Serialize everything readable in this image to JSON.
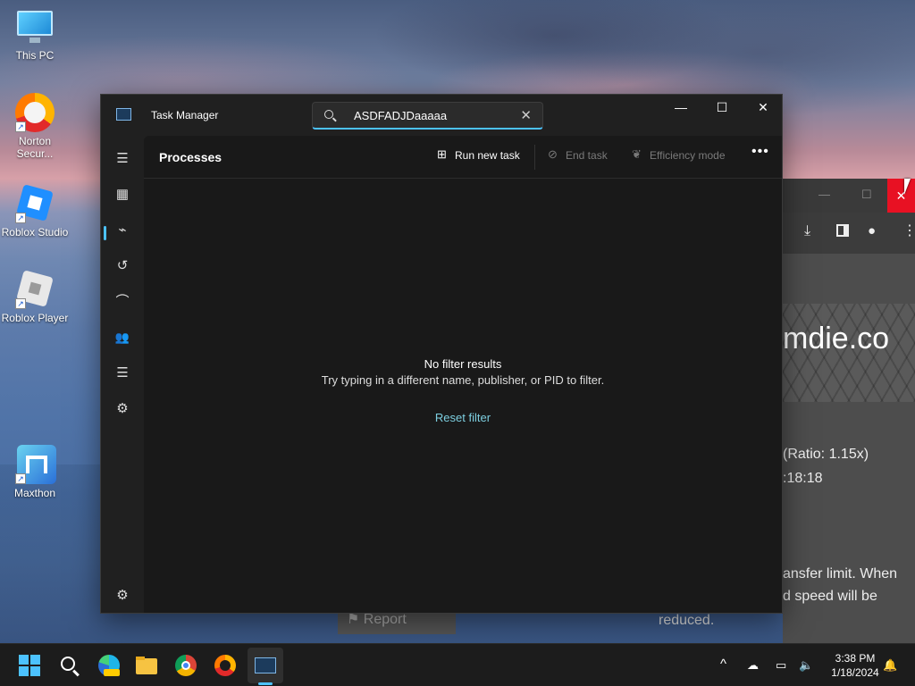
{
  "desktop": {
    "icons": [
      {
        "label": "This PC"
      },
      {
        "label": "Norton Secur..."
      },
      {
        "label": "Roblox Studio"
      },
      {
        "label": "Roblox Player"
      },
      {
        "label": "Maxthon"
      }
    ]
  },
  "background_browser": {
    "close_glyph": "✕",
    "heading_fragment": "mdie.co",
    "ratio_text": "(Ratio: 1.15x)",
    "time_text": ":18:18",
    "limit_line1": "ansfer limit. When",
    "limit_line2": "d speed will be",
    "limit_line3": "reduced.",
    "report_label": "Report"
  },
  "task_manager": {
    "title": "Task Manager",
    "search": {
      "value": "ASDFADJDaaaaa",
      "clear_glyph": "✕"
    },
    "window_buttons": {
      "minimize": "—",
      "maximize": "☐",
      "close": "✕"
    },
    "page_title": "Processes",
    "commands": {
      "run_new_task": "Run new task",
      "end_task": "End task",
      "efficiency_mode": "Efficiency mode",
      "more": "•••"
    },
    "empty_state": {
      "title": "No filter results",
      "subtitle": "Try typing in a different name, publisher, or PID to filter.",
      "reset": "Reset filter"
    },
    "sidebar": [
      {
        "name": "hamburger-icon",
        "glyph": "☰"
      },
      {
        "name": "processes-icon",
        "glyph": "▦"
      },
      {
        "name": "performance-icon",
        "glyph": "⌁"
      },
      {
        "name": "app-history-icon",
        "glyph": "↺"
      },
      {
        "name": "startup-apps-icon",
        "glyph": "⌒"
      },
      {
        "name": "users-icon",
        "glyph": "👥"
      },
      {
        "name": "details-icon",
        "glyph": "☰"
      },
      {
        "name": "services-icon",
        "glyph": "⚙"
      },
      {
        "name": "settings-icon",
        "glyph": "⚙"
      }
    ]
  },
  "taskbar": {
    "clock_time": "3:38 PM",
    "clock_date": "1/18/2024",
    "tray_chevron": "^"
  },
  "colors": {
    "accent": "#4cc2ff",
    "link": "#7dcfe0",
    "close_red": "#e81123"
  }
}
